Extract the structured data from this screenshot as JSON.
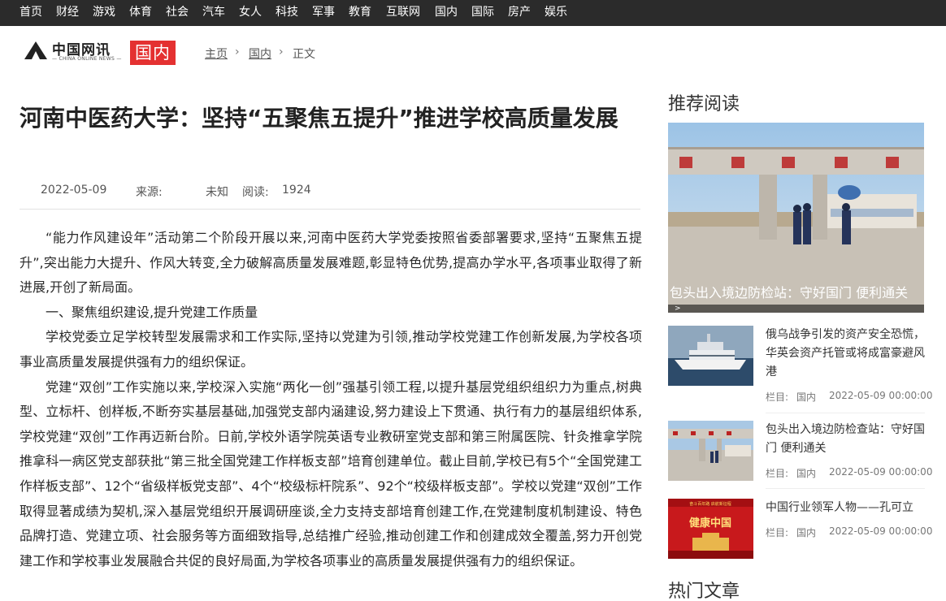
{
  "topnav": [
    "首页",
    "财经",
    "游戏",
    "体育",
    "社会",
    "汽车",
    "女人",
    "科技",
    "军事",
    "教育",
    "互联网",
    "国内",
    "国际",
    "房产",
    "娱乐"
  ],
  "logo": {
    "cn": "中国网讯",
    "en": "— CHINA ONLINE NEWS —"
  },
  "channel": "国内",
  "breadcrumb": [
    "主页",
    "国内",
    "正文"
  ],
  "article": {
    "title": "河南中医药大学：坚持“五聚焦五提升”推进学校高质量发展",
    "date": "2022-05-09",
    "source_label": "来源:",
    "source_value": "未知",
    "views_label": "阅读:",
    "views": "1924",
    "paragraphs": [
      "“能力作风建设年”活动第二个阶段开展以来,河南中医药大学党委按照省委部署要求,坚持“五聚焦五提升”,突出能力大提升、作风大转变,全力破解高质量发展难题,彰显特色优势,提高办学水平,各项事业取得了新进展,开创了新局面。",
      "一、聚焦组织建设,提升党建工作质量",
      "学校党委立足学校转型发展需求和工作实际,坚持以党建为引领,推动学校党建工作创新发展,为学校各项事业高质量发展提供强有力的组织保证。",
      "党建“双创”工作实施以来,学校深入实施“两化一创”强基引领工程,以提升基层党组织组织力为重点,树典型、立标杆、创样板,不断夯实基层基础,加强党支部内涵建设,努力建设上下贯通、执行有力的基层组织体系,学校党建“双创”工作再迈新台阶。日前,学校外语学院英语专业教研室党支部和第三附属医院、针灸推拿学院推拿科一病区党支部获批“第三批全国党建工作样板支部”培育创建单位。截止目前,学校已有5个“全国党建工作样板支部”、12个“省级样板党支部”、4个“校级标杆院系”、92个“校级样板支部”。学校以党建“双创”工作取得显著成绩为契机,深入基层党组织开展调研座谈,全力支持支部培育创建工作,在党建制度机制建设、特色品牌打造、党建立项、社会服务等方面细致指导,总结推广经验,推动创建工作和创建成效全覆盖,努力开创党建工作和学校事业发展融合共促的良好局面,为学校各项事业的高质量发展提供强有力的组织保证。"
    ]
  },
  "sidebar": {
    "recommend_heading": "推荐阅读",
    "feature": {
      "caption": "包头出入境边防检站：守好国门 便利通关"
    },
    "feature_arrow": ">",
    "items": [
      {
        "title": "俄乌战争引发的资产安全恐慌，华英会资产托管或将成富豪避风港",
        "col_label": "栏目:",
        "col_value": "国内",
        "time": "2022-05-09 00:00:00"
      },
      {
        "title": "包头出入境边防检查站：守好国门 便利通关",
        "col_label": "栏目:",
        "col_value": "国内",
        "time": "2022-05-09 00:00:00"
      },
      {
        "title": "中国行业领军人物——孔可立",
        "col_label": "栏目:",
        "col_value": "国内",
        "time": "2022-05-09 00:00:00"
      }
    ],
    "thumb3_banner": "奋斗百年路 启航新征程",
    "thumb3_text": "健康中国",
    "hot_heading": "热门文章"
  }
}
